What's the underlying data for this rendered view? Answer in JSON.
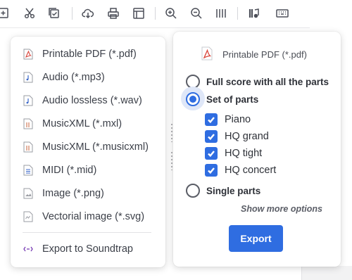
{
  "toolbar": {
    "icons": [
      "add-box-icon",
      "scissors-icon",
      "checkbox-copy-icon",
      "cloud-download-icon",
      "print-icon",
      "layout-icon",
      "zoom-in-icon",
      "zoom-out-icon",
      "barlines-icon",
      "instrument-icon",
      "keyboard-icon"
    ]
  },
  "menu": {
    "items": [
      {
        "label": "Printable PDF (*.pdf)",
        "icon": "pdf-file-icon"
      },
      {
        "label": "Audio (*.mp3)",
        "icon": "audio-file-icon"
      },
      {
        "label": "Audio lossless (*.wav)",
        "icon": "audio-file-icon"
      },
      {
        "label": "MusicXML (*.mxl)",
        "icon": "musicxml-file-icon"
      },
      {
        "label": "MusicXML (*.musicxml)",
        "icon": "musicxml-file-icon"
      },
      {
        "label": "MIDI (*.mid)",
        "icon": "midi-file-icon"
      },
      {
        "label": "Image (*.png)",
        "icon": "image-file-icon"
      },
      {
        "label": "Vectorial image (*.svg)",
        "icon": "svg-file-icon"
      }
    ],
    "soundtrap": {
      "label": "Export to Soundtrap",
      "icon": "soundtrap-icon"
    }
  },
  "panel": {
    "title": "Printable PDF (*.pdf)",
    "options": {
      "full_score": "Full score with all the parts",
      "set_of_parts": "Set of parts",
      "single_parts": "Single parts",
      "selected": "set_of_parts"
    },
    "parts": [
      {
        "label": "Piano",
        "checked": true
      },
      {
        "label": "HQ grand",
        "checked": true
      },
      {
        "label": "HQ tight",
        "checked": true
      },
      {
        "label": "HQ concert",
        "checked": true
      }
    ],
    "more_link": "Show more options",
    "export_label": "Export"
  },
  "colors": {
    "accent": "#2f6de1",
    "pdf_red": "#d9453b",
    "audio_blue": "#3a66c8",
    "soundtrap_purple": "#7a3fb5"
  }
}
